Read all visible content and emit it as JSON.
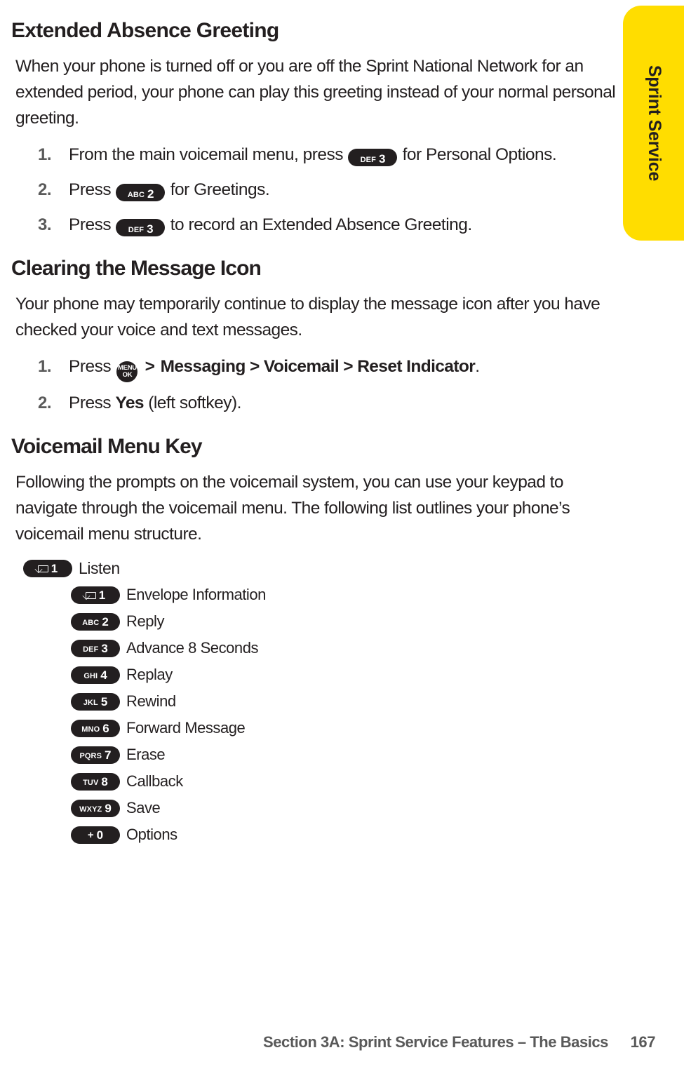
{
  "side_tab": {
    "label": "Sprint Service",
    "color": "#FFDD00"
  },
  "sections": [
    {
      "heading": "Extended Absence Greeting",
      "paragraph": "When your phone is turned off or you are off the Sprint National Network for an extended period, your phone can play this greeting instead of your normal personal greeting.",
      "steps": [
        {
          "num": "1.",
          "before": "From the main voicemail menu, press ",
          "key": {
            "letters": "DEF",
            "digit": "3"
          },
          "after": " for Personal Options."
        },
        {
          "num": "2.",
          "before": "Press ",
          "key": {
            "letters": "ABC",
            "digit": "2"
          },
          "after": " for Greetings."
        },
        {
          "num": "3.",
          "before": "Press ",
          "key": {
            "letters": "DEF",
            "digit": "3"
          },
          "after": " to record an Extended Absence Greeting."
        }
      ]
    },
    {
      "heading": "Clearing the Message Icon",
      "paragraph": "Your phone may temporarily continue to display the message icon after you have checked your voice and text messages.",
      "steps": [
        {
          "num": "1.",
          "before": "Press ",
          "menu_key": {
            "line1": "MENU",
            "line2": "OK"
          },
          "arrow": ">",
          "bold_path": "Messaging > Voicemail > Reset Indicator",
          "after": "."
        },
        {
          "num": "2.",
          "before": "Press ",
          "bold": "Yes",
          "after": " (left softkey)."
        }
      ]
    },
    {
      "heading": "Voicemail Menu Key",
      "paragraph": "Following the prompts on the voicemail system, you can use your keypad to navigate through the voicemail menu. The following list outlines your phone’s voicemail menu structure."
    }
  ],
  "voicemail_menu": [
    {
      "level": 0,
      "key": {
        "icon": "envelope",
        "digit": "1"
      },
      "label": "Listen"
    },
    {
      "level": 1,
      "key": {
        "icon": "envelope",
        "digit": "1"
      },
      "label": "Envelope Information"
    },
    {
      "level": 1,
      "key": {
        "letters": "ABC",
        "digit": "2"
      },
      "label": "Reply"
    },
    {
      "level": 1,
      "key": {
        "letters": "DEF",
        "digit": "3"
      },
      "label": "Advance 8 Seconds"
    },
    {
      "level": 1,
      "key": {
        "letters": "GHI",
        "digit": "4"
      },
      "label": "Replay"
    },
    {
      "level": 1,
      "key": {
        "letters": "JKL",
        "digit": "5"
      },
      "label": "Rewind"
    },
    {
      "level": 1,
      "key": {
        "letters": "MNO",
        "digit": "6"
      },
      "label": "Forward Message"
    },
    {
      "level": 1,
      "key": {
        "letters": "PQRS",
        "digit": "7"
      },
      "label": "Erase"
    },
    {
      "level": 1,
      "key": {
        "letters": "TUV",
        "digit": "8"
      },
      "label": "Callback"
    },
    {
      "level": 1,
      "key": {
        "letters": "WXYZ",
        "digit": "9"
      },
      "label": "Save"
    },
    {
      "level": 1,
      "key": {
        "icon": "plus",
        "digit": "0"
      },
      "label": "Options"
    }
  ],
  "footer": {
    "text": "Section 3A: Sprint Service Features – The Basics",
    "page": "167"
  }
}
